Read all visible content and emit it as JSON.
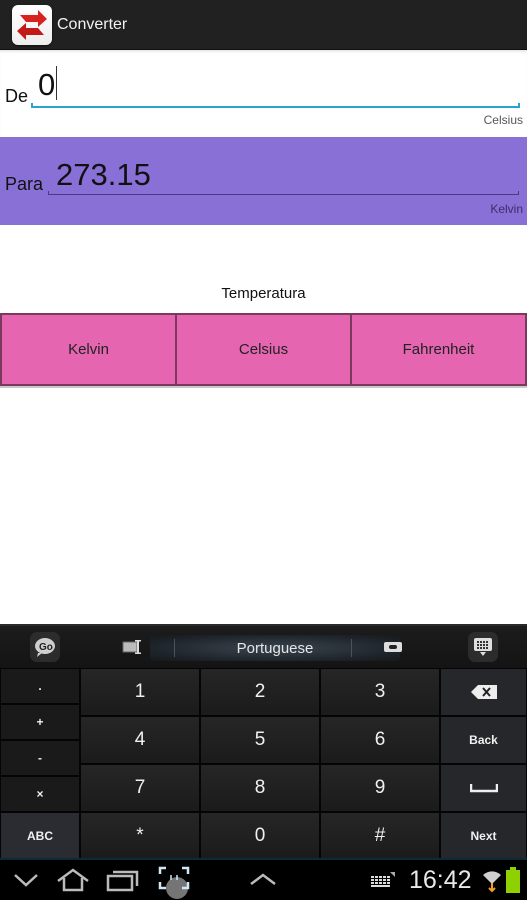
{
  "app": {
    "title": "Converter",
    "icon": "converter-arrows-icon"
  },
  "converter": {
    "from": {
      "label": "De",
      "value": "0",
      "unit": "Celsius"
    },
    "to": {
      "label": "Para",
      "value": "273.15",
      "unit": "Kelvin"
    },
    "category": "Temperatura",
    "unit_buttons": [
      {
        "label": "Kelvin"
      },
      {
        "label": "Celsius"
      },
      {
        "label": "Fahrenheit"
      }
    ]
  },
  "colors": {
    "action_bar": "#212121",
    "to_row": "#8870d6",
    "unit_button": "#e565b0",
    "input_underline": "#2aa3d0"
  },
  "keyboard": {
    "toolbar": {
      "go_icon": "go-keyboard-icon",
      "cursor_icon": "text-cursor-icon",
      "language": "Portuguese",
      "tape_icon": "clipboard-icon",
      "hide_icon": "keyboard-hide-icon"
    },
    "side_keys": [
      ".",
      "+",
      "-",
      "×",
      "ABC"
    ],
    "num_keys": [
      "1",
      "2",
      "3",
      "4",
      "5",
      "6",
      "7",
      "8",
      "9",
      "*",
      "0",
      "#"
    ],
    "func_keys": {
      "backspace_icon": "backspace-icon",
      "back": "Back",
      "space_icon": "space-icon",
      "next": "Next"
    }
  },
  "statusbar": {
    "time": "16:42",
    "icons": [
      "keyboard-notification-icon",
      "wifi-icon",
      "battery-icon"
    ]
  },
  "navbar": {
    "icons": [
      "hide-keyboard-icon",
      "home-icon",
      "recent-apps-icon",
      "screenshot-icon",
      "menu-up-icon"
    ]
  }
}
